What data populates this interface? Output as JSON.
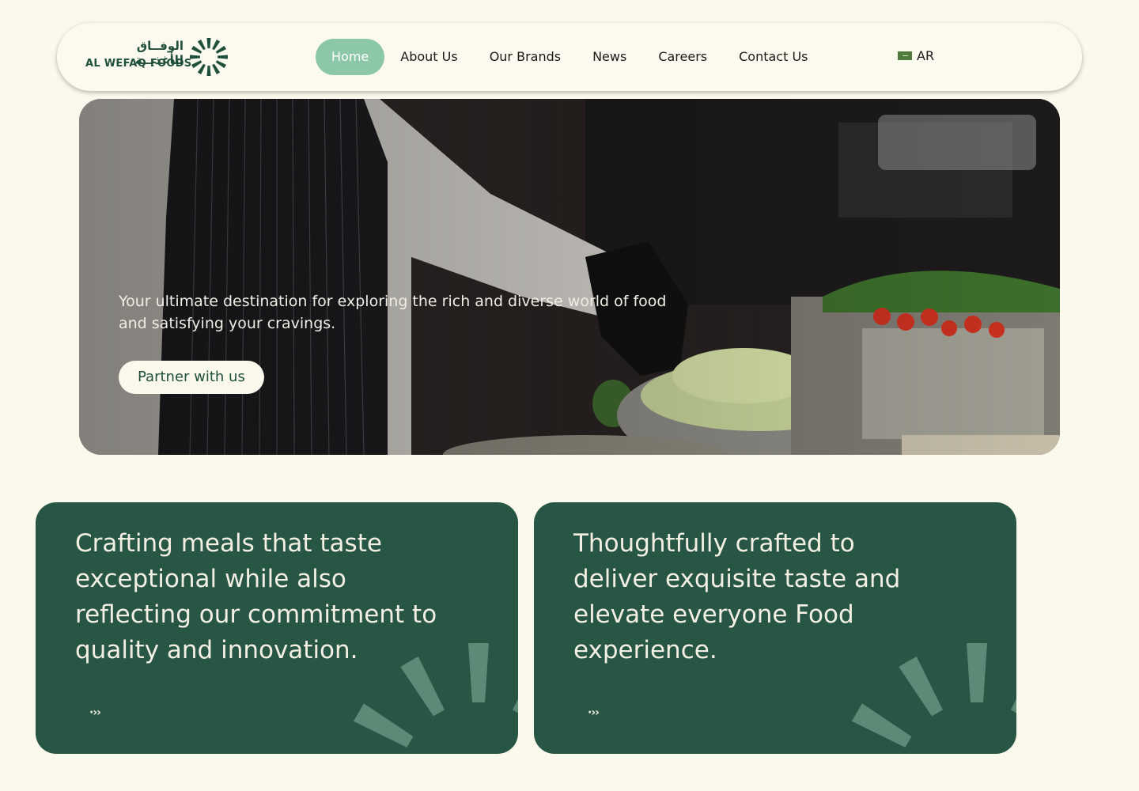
{
  "header": {
    "logo": {
      "arabic": "الوفــاق للأغذيــة",
      "english": "AL WEFAQ FOODS"
    },
    "nav": [
      {
        "label": "Home",
        "active": true
      },
      {
        "label": "About Us",
        "active": false
      },
      {
        "label": "Our Brands",
        "active": false
      },
      {
        "label": "News",
        "active": false
      },
      {
        "label": "Careers",
        "active": false
      },
      {
        "label": "Contact Us",
        "active": false
      }
    ],
    "language": "AR"
  },
  "hero": {
    "text": "Your ultimate destination for exploring the rich and diverse world of food and satisfying your cravings.",
    "button_label": "Partner with us"
  },
  "cards": [
    {
      "text": "Crafting meals that taste exceptional while also reflecting our commitment to quality and innovation.",
      "arrow": "·››"
    },
    {
      "text": "Thoughtfully crafted to deliver exquisite taste and elevate everyone Food experience.",
      "arrow": "·››"
    }
  ],
  "colors": {
    "page_bg": "#fbf9ec",
    "brand_green": "#275645",
    "nav_active": "#8cc7a8",
    "logo_green": "#1f4f3b"
  }
}
